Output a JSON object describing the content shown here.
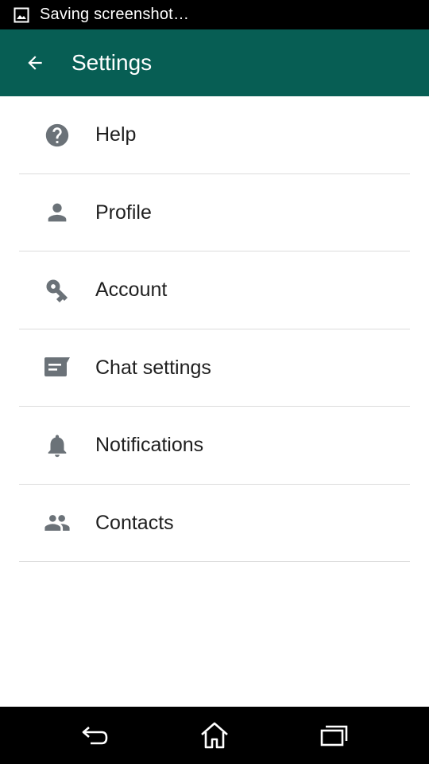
{
  "status_bar": {
    "notification_icon": "image-icon",
    "text": "Saving screenshot…"
  },
  "app_bar": {
    "back_icon": "arrow-back-icon",
    "title": "Settings",
    "background_color": "#075e54"
  },
  "settings": {
    "items": [
      {
        "icon": "help-circle-icon",
        "label": "Help"
      },
      {
        "icon": "person-icon",
        "label": "Profile"
      },
      {
        "icon": "key-icon",
        "label": "Account"
      },
      {
        "icon": "chat-icon",
        "label": "Chat settings"
      },
      {
        "icon": "bell-icon",
        "label": "Notifications"
      },
      {
        "icon": "people-icon",
        "label": "Contacts"
      }
    ],
    "icon_color": "#6b7278"
  },
  "nav_bar": {
    "buttons": [
      "back-icon",
      "home-icon",
      "recent-apps-icon"
    ]
  }
}
